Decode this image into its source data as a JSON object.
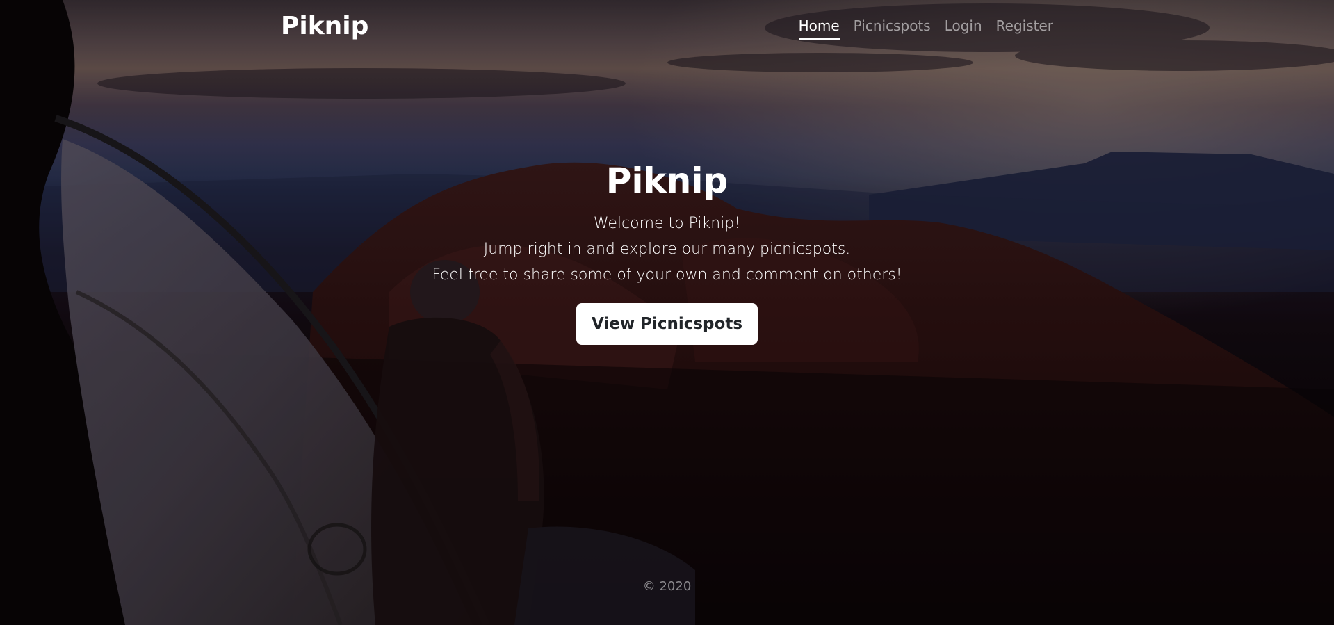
{
  "navbar": {
    "brand": "Piknip",
    "links": [
      {
        "label": "Home",
        "active": true
      },
      {
        "label": "Picnicspots",
        "active": false
      },
      {
        "label": "Login",
        "active": false
      },
      {
        "label": "Register",
        "active": false
      }
    ]
  },
  "hero": {
    "title": "Piknip",
    "lines": [
      "Welcome to Piknip!",
      "Jump right in and explore our many picnicspots.",
      "Feel free to share some of your own and comment on others!"
    ],
    "button_label": "View Picnicspots"
  },
  "footer": {
    "copyright": "© 2020"
  },
  "colors": {
    "text": "#ffffff",
    "button_bg": "#ffffff",
    "button_text": "#212529"
  }
}
